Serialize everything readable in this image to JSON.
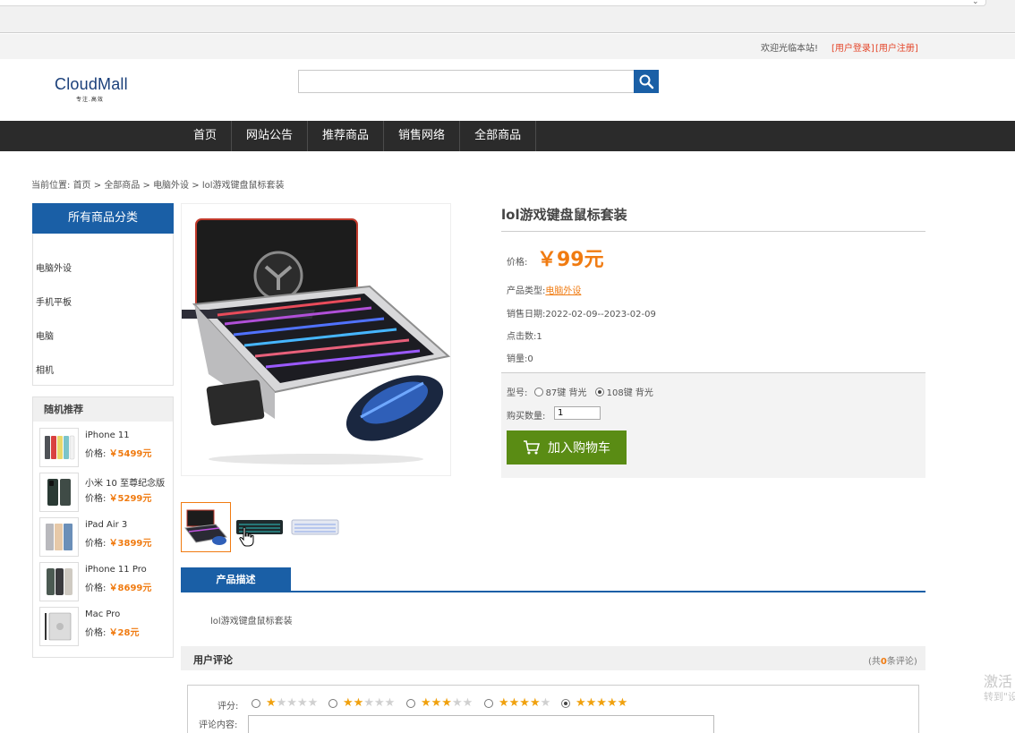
{
  "topbar": {
    "welcome": "欢迎光临本站!",
    "login": "[用户登录]",
    "register": "[用户注册]"
  },
  "header": {
    "logo": "CloudMall",
    "logo_sub": "专注.高效",
    "search_placeholder": ""
  },
  "nav": [
    "首页",
    "网站公告",
    "推荐商品",
    "销售网络",
    "全部商品"
  ],
  "breadcrumb": {
    "prefix": "当前位置: ",
    "home": "首页",
    "sep": " > ",
    "all": "全部商品",
    "category": "电脑外设",
    "product": "lol游戏键盘鼠标套装"
  },
  "sidebar": {
    "categories_title": "所有商品分类",
    "categories": [
      "电脑外设",
      "手机平板",
      "电脑",
      "相机"
    ],
    "recommend_title": "随机推荐",
    "price_label": "价格:",
    "recommend": [
      {
        "name": "iPhone 11",
        "price": "￥5499元"
      },
      {
        "name": "小米 10 至尊纪念版",
        "price": "￥5299元"
      },
      {
        "name": "iPad Air 3",
        "price": "￥3899元"
      },
      {
        "name": "iPhone 11 Pro",
        "price": "￥8699元"
      },
      {
        "name": "Mac Pro",
        "price": "￥28元"
      }
    ]
  },
  "product": {
    "title": "lol游戏键盘鼠标套装",
    "price_label": "价格:",
    "price": "￥99元",
    "type_label": "产品类型:",
    "type_value": "电脑外设",
    "date_label": "销售日期:",
    "date_value": "2022-02-09--2023-02-09",
    "clicks_label": "点击数:",
    "clicks_value": "1",
    "sales_label": "销量:",
    "sales_value": "0",
    "model_label": "型号:",
    "models": [
      "87键 背光",
      "108键 背光"
    ],
    "selected_model": "108键 背光",
    "qty_label": "购买数量:",
    "qty_value": "1",
    "cart_button": "加入购物车"
  },
  "description": {
    "tab": "产品描述",
    "text": "lol游戏键盘鼠标套装"
  },
  "comments": {
    "title": "用户评论",
    "count_prefix": "(共",
    "count": "0",
    "count_suffix": "条评论)",
    "rating_label": "评分:",
    "ratings": [
      1,
      2,
      3,
      4,
      5
    ],
    "selected_rating": 5,
    "content_label": "评论内容:"
  },
  "watermark": {
    "line1": "激活",
    "line2": "转到\"设"
  },
  "colors": {
    "brand_blue": "#1a5fa6",
    "price_orange": "#f07b11",
    "cart_green": "#5a8c14",
    "nav_dark": "#2b2b2b"
  }
}
